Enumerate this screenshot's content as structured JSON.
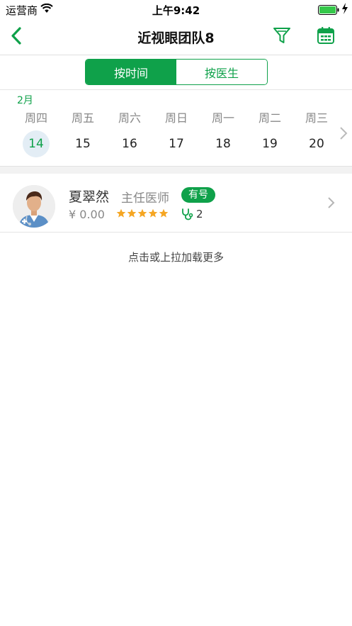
{
  "status_bar": {
    "carrier": "运营商",
    "time": "上午9:42"
  },
  "nav": {
    "title": "近视眼团队8"
  },
  "segment": {
    "by_time": "按时间",
    "by_doctor": "按医生"
  },
  "calendar": {
    "month": "2月",
    "weekdays": [
      "周四",
      "周五",
      "周六",
      "周日",
      "周一",
      "周二",
      "周三"
    ],
    "dates": [
      "14",
      "15",
      "16",
      "17",
      "18",
      "19",
      "20"
    ],
    "selected_date": "14"
  },
  "doctor": {
    "name": "夏翠然",
    "title": "主任医师",
    "badge": "有号",
    "price": "¥  0.00",
    "rating_stars": 5,
    "consult_count": "2"
  },
  "load_more": "点击或上拉加载更多",
  "colors": {
    "accent": "#0fa14a",
    "star": "#f5a623",
    "selected_bg": "#e3edf5"
  },
  "icons": [
    "back-chevron-icon",
    "filter-funnel-icon",
    "calendar-icon",
    "chevron-right-icon",
    "star-icon",
    "stethoscope-icon",
    "doctor-avatar"
  ]
}
